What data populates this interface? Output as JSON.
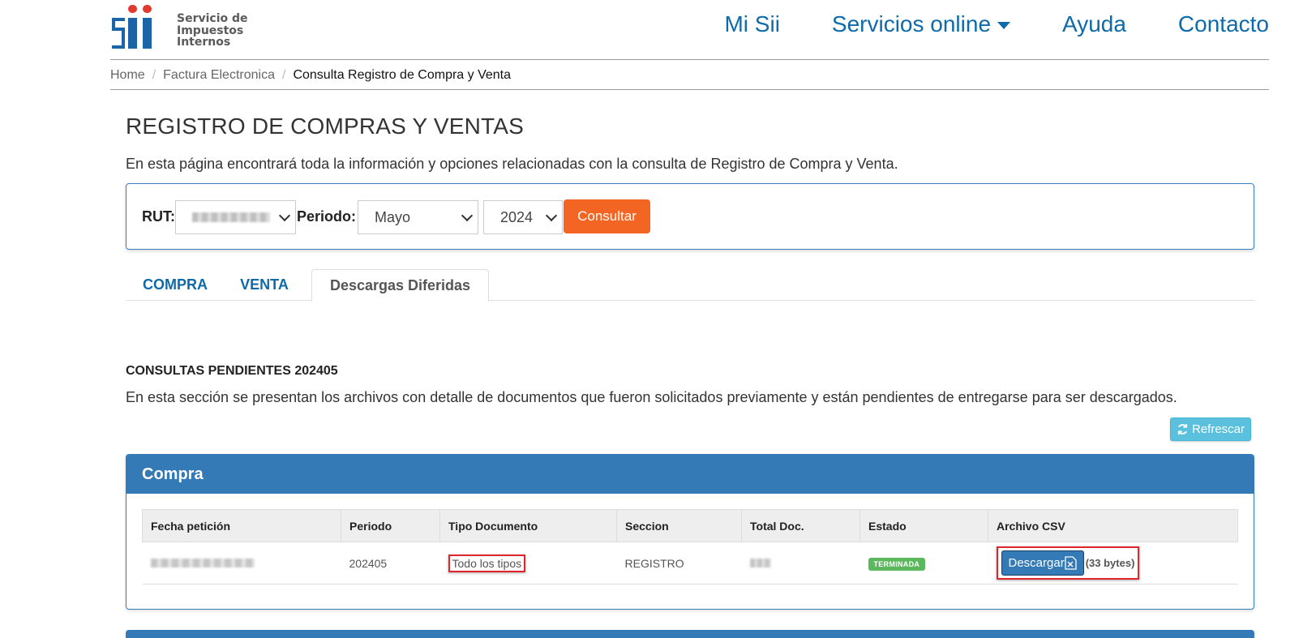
{
  "header": {
    "logo_lines": [
      "Servicio de",
      "Impuestos",
      "Internos"
    ],
    "logo_mark": "Sii",
    "nav": {
      "mi_sii": "Mi Sii",
      "servicios": "Servicios online",
      "ayuda": "Ayuda",
      "contacto": "Contacto"
    }
  },
  "breadcrumb": {
    "home": "Home",
    "factura": "Factura Electronica",
    "current": "Consulta Registro de Compra y Venta",
    "separator": "/"
  },
  "page": {
    "title": "REGISTRO DE COMPRAS Y VENTAS",
    "description": "En esta página encontrará toda la información y opciones relacionadas con la consulta de Registro de Compra y Venta."
  },
  "filter": {
    "rut_label": "RUT:",
    "periodo_label": "Periodo:",
    "month_value": "Mayo",
    "year_value": "2024",
    "consultar_label": "Consultar"
  },
  "tabs": [
    "COMPRA",
    "VENTA",
    "Descargas Diferidas"
  ],
  "active_tab": "Descargas Diferidas",
  "pendientes": {
    "title": "CONSULTAS PENDIENTES 202405",
    "description": "En esta sección se presentan los archivos con detalle de documentos que fueron solicitados previamente y están pendientes de entregarse para ser descargados.",
    "refrescar_label": "Refrescar"
  },
  "compra_panel": {
    "title": "Compra",
    "columns": [
      "Fecha petición",
      "Periodo",
      "Tipo Documento",
      "Seccion",
      "Total Doc.",
      "Estado",
      "Archivo CSV"
    ],
    "rows": [
      {
        "periodo": "202405",
        "tipo_documento": "Todo los tipos",
        "seccion": "REGISTRO",
        "estado": "TERMINADA",
        "descargar_label": "Descargar",
        "size": "(33 bytes)"
      }
    ]
  },
  "colors": {
    "brand_blue": "#0e6aa8",
    "panel_blue": "#337ab7",
    "accent_orange": "#f26522",
    "info_cyan": "#5bc0de",
    "success_green": "#5cb85c",
    "highlight_red": "#e0262c"
  },
  "icons": {
    "logo": "sii-logo-icon",
    "dropdown": "caret-down-icon",
    "refresh": "refresh-icon",
    "excel": "excel-file-icon"
  }
}
